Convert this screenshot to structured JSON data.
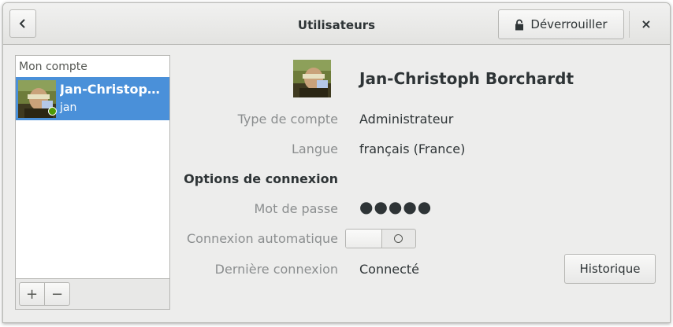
{
  "window": {
    "title": "Utilisateurs"
  },
  "header": {
    "back_icon": "chevron-left-icon",
    "unlock_label": "Déverrouiller",
    "unlock_icon": "lock-icon",
    "close_glyph": "×"
  },
  "sidebar": {
    "section_label": "Mon compte",
    "users": [
      {
        "name": "Jan-Christoph Borchardt",
        "login": "jan",
        "online": true,
        "selected": true
      }
    ],
    "add_label": "+",
    "remove_label": "−"
  },
  "details": {
    "full_name": "Jan-Christoph Borchardt",
    "account_type_label": "Type de compte",
    "account_type_value": "Administrateur",
    "language_label": "Langue",
    "language_value": "français (France)",
    "login_options_heading": "Options de connexion",
    "password_label": "Mot de passe",
    "password_value": "●●●●●",
    "auto_login_label": "Connexion automatique",
    "auto_login_enabled": false,
    "last_login_label": "Dernière connexion",
    "last_login_value": "Connecté",
    "history_button": "Historique"
  },
  "colors": {
    "selection": "#4a90d9",
    "online": "#4e9a06",
    "dim_label": "#8b8e8f"
  }
}
